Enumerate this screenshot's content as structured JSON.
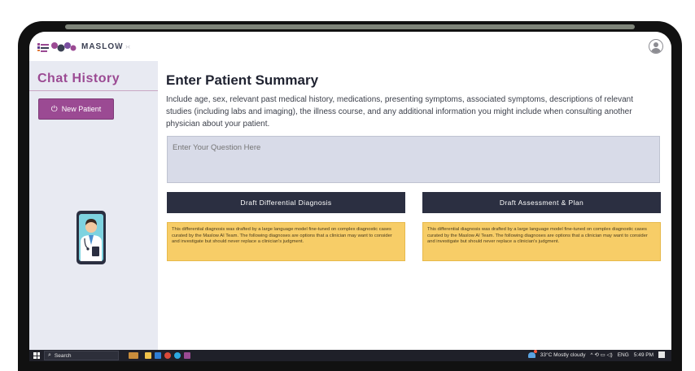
{
  "app": {
    "brand": "MASLOW",
    "brand_sep": "|",
    "brand_ext": "›‹"
  },
  "sidebar": {
    "title": "Chat History",
    "new_patient_label": "New Patient",
    "new_patient_icon": "power-icon"
  },
  "main": {
    "title": "Enter Patient Summary",
    "description": "Include age, sex, relevant past medical history, medications, presenting symptoms, associated symptoms, descriptions of relevant studies (including labs and imaging), the illness course, and any additional information you might include when consulting another physician about your patient.",
    "question_placeholder": "Enter Your Question Here",
    "buttons": {
      "ddx": "Draft Differential Diagnosis",
      "ap": "Draft Assessment & Plan"
    },
    "notes": {
      "left": "This differential diagnosis was drafted by a large language model fine-tuned on complex diagnostic cases curated by the Maslow AI Team. The following diagnoses are options that a clinician may want to consider and investigate but should never replace a clinician's judgment.",
      "right": "This differential diagnosis was drafted by a large language model fine-tuned on complex diagnostic cases curated by the Maslow AI Team. The following diagnoses are options that a clinician may want to consider and investigate but should never replace a clinician's judgment."
    }
  },
  "taskbar": {
    "search_label": "Search",
    "weather": "33°C  Mostly cloudy",
    "tray_icons": "^ ⟲ ▭ ◁)",
    "lang": "ENG",
    "time": "5:49 PM"
  },
  "colors": {
    "accent": "#9b4a93",
    "sidebar_bg": "#e8eaf2",
    "dark_button": "#2b2f41",
    "note_bg": "#f7cd67",
    "taskbar": "#1f2029"
  }
}
